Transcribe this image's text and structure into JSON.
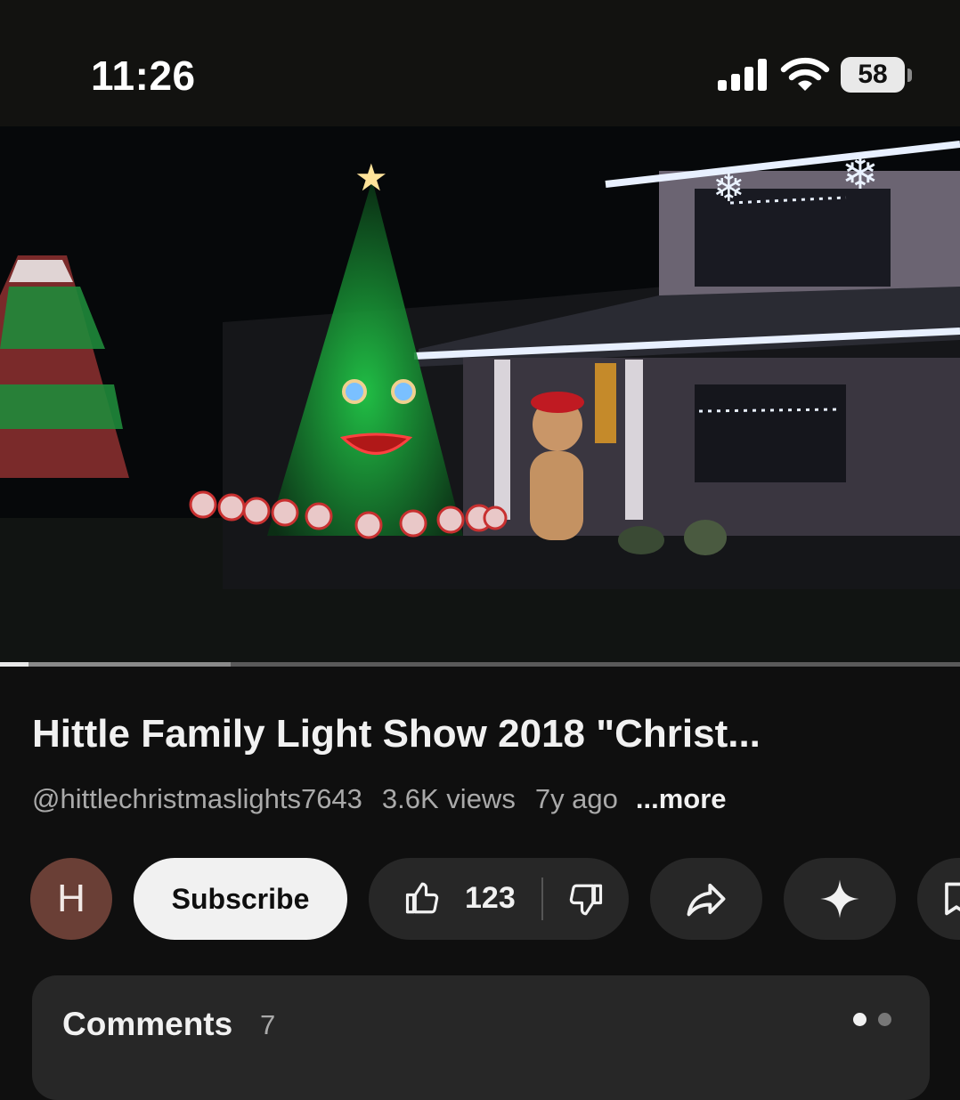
{
  "status_bar": {
    "time": "11:26",
    "battery_level": "58",
    "icons": [
      "cellular-signal-icon",
      "wifi-icon",
      "battery-icon"
    ]
  },
  "video": {
    "thumbnail_description_icon": "video-player",
    "progress_fraction": 0.03,
    "buffered_fraction": 0.24
  },
  "title": "Hittle Family Light Show 2018 \"Christ...",
  "meta": {
    "channel": "@hittlechristmaslights7643",
    "views": "3.6K views",
    "age": "7y ago",
    "more": "...more"
  },
  "actions": {
    "avatar_letter": "H",
    "subscribe_label": "Subscribe",
    "like_count": "123",
    "icons": [
      "thumbs-up-icon",
      "thumbs-down-icon",
      "share-icon",
      "sparkle-icon",
      "save-icon"
    ]
  },
  "comments": {
    "label": "Comments",
    "count": "7"
  },
  "colors": {
    "background": "#0f0f0f",
    "button_bg": "#272727",
    "subscribe_bg": "#f1f1f1",
    "avatar_bg": "#6a3f36",
    "secondary_text": "#aaaaaa"
  }
}
